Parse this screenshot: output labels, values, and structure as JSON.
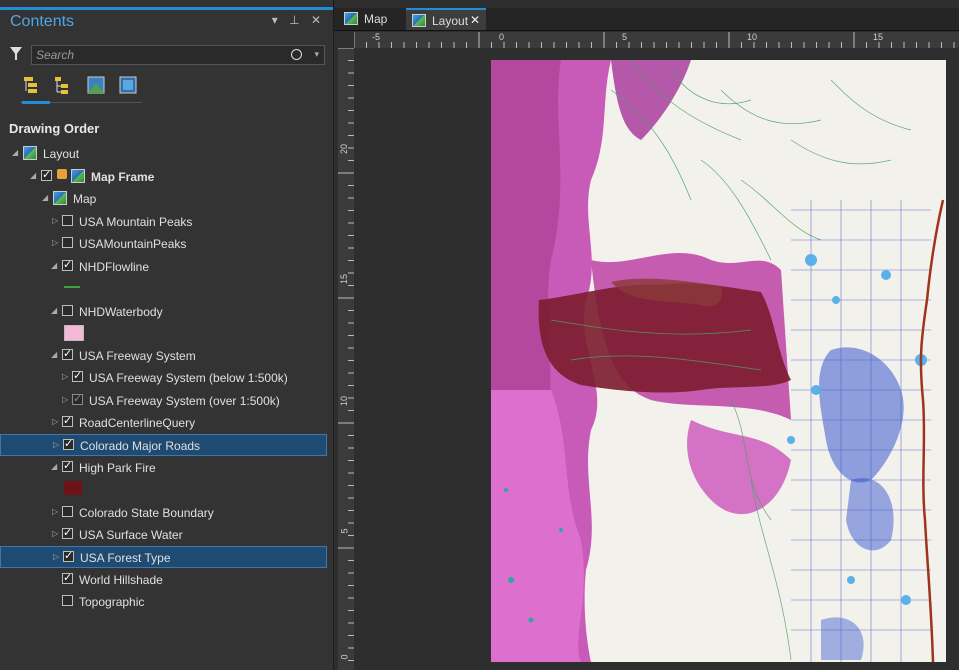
{
  "contents": {
    "title": "Contents",
    "controls": "▾ ⊥ ✕",
    "search_placeholder": "Search",
    "section_title": "Drawing Order"
  },
  "tree": [
    {
      "label": "Layout"
    },
    {
      "label": "Map Frame"
    },
    {
      "label": "Map"
    },
    {
      "label": "USA Mountain Peaks"
    },
    {
      "label": "USAMountainPeaks"
    },
    {
      "label": "NHDFlowline"
    },
    {
      "label": "NHDWaterbody"
    },
    {
      "label": "USA Freeway System"
    },
    {
      "label": "USA Freeway System (below 1:500k)"
    },
    {
      "label": "USA Freeway System (over 1:500k)"
    },
    {
      "label": "RoadCenterlineQuery"
    },
    {
      "label": "Colorado Major Roads"
    },
    {
      "label": "High Park Fire"
    },
    {
      "label": "Colorado State Boundary"
    },
    {
      "label": "USA Surface Water"
    },
    {
      "label": "USA Forest Type"
    },
    {
      "label": "World Hillshade"
    },
    {
      "label": "Topographic"
    }
  ],
  "tabs": [
    {
      "label": "Map"
    },
    {
      "label": "Layout",
      "close": "✕"
    }
  ],
  "ruler": {
    "h": [
      "-5",
      "0",
      "5",
      "10",
      "15"
    ],
    "v": [
      "20",
      "15",
      "10",
      "5",
      "0"
    ]
  },
  "colors": {
    "accent": "#1e8fd6",
    "selected_row": "#1f4a72",
    "waterbody_swatch": "#f4b9d7",
    "fire_swatch": "#6e1418",
    "flowline_swatch": "#3da23d"
  }
}
